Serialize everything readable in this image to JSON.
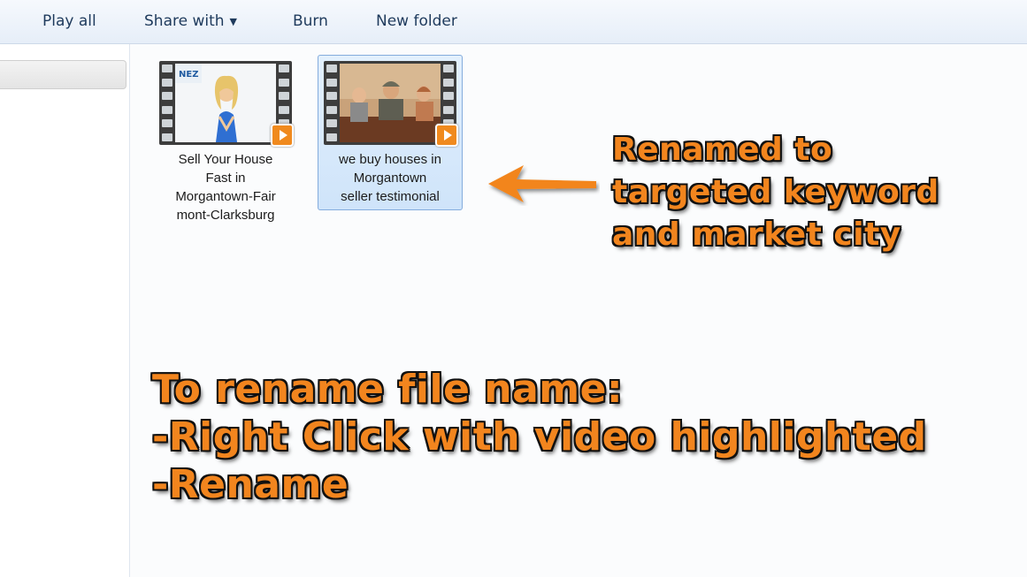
{
  "toolbar": {
    "play_all": "Play all",
    "share_with": "Share with",
    "burn": "Burn",
    "new_folder": "New folder"
  },
  "files": [
    {
      "name_lines": [
        "Sell Your House",
        "Fast in",
        "Morgantown-Fair",
        "mont-Clarksburg"
      ],
      "selected": false,
      "thumb_logo": "NEZ"
    },
    {
      "name_lines": [
        "we buy houses in",
        "Morgantown",
        "seller testimonial"
      ],
      "selected": true
    }
  ],
  "annotations": {
    "callout_top": [
      "Renamed to",
      "targeted keyword",
      "and market city"
    ],
    "callout_bottom": [
      "To rename file name:",
      "-Right Click with video highlighted",
      "-Rename"
    ]
  },
  "colors": {
    "accent_orange": "#f2851e",
    "selection_bg": "#cfe4fa",
    "selection_border": "#84acdd",
    "toolbar_text": "#1e3a5c"
  },
  "icons": {
    "dropdown": "chevron-down-icon",
    "play": "play-icon",
    "arrow": "arrow-left-icon"
  }
}
